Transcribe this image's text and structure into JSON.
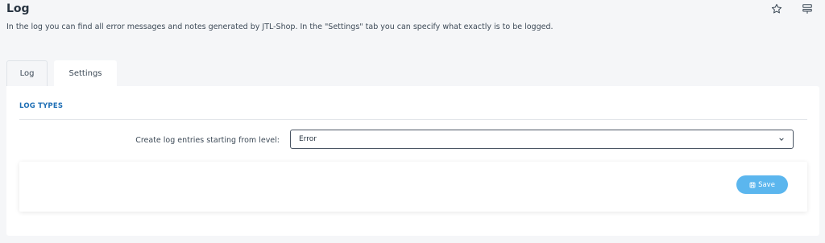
{
  "header": {
    "title": "Log",
    "description": "In the log you can find all error messages and notes generated by JTL-Shop. In the \"Settings\" tab you can specify what exactly is to be logged.",
    "icons": [
      "star-icon",
      "settings-sliders-icon"
    ]
  },
  "tabs": [
    {
      "label": "Log",
      "active": false
    },
    {
      "label": "Settings",
      "active": true
    }
  ],
  "settings": {
    "section_title": "LOG TYPES",
    "level_label": "Create log entries starting from level:",
    "level_value": "Error",
    "save_label": "Save"
  },
  "colors": {
    "accent": "#1f6fb5",
    "save_button": "#5bb6ee",
    "background": "#f5f6f8"
  }
}
